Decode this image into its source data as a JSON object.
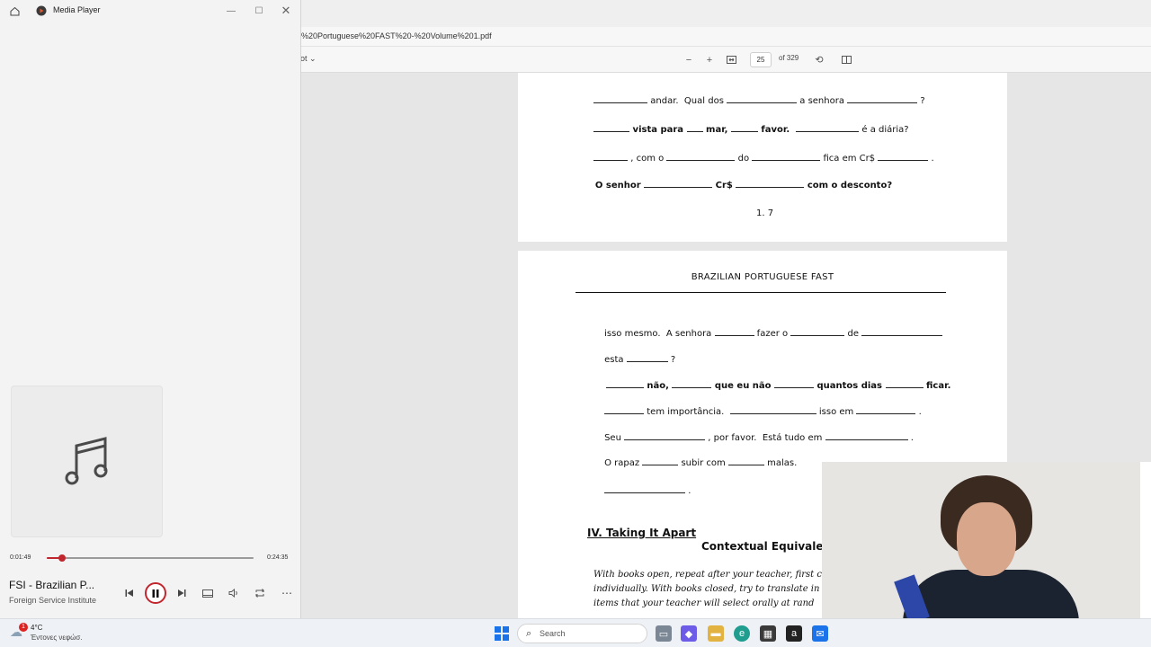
{
  "pdf_viewer": {
    "url_fragment": "%20Portuguese%20FAST%20-%20Volume%201.pdf",
    "draw_label": "ot",
    "page_current": "25",
    "page_of": "of 329",
    "page1": {
      "lines": [
        [
          "",
          " andar.  Qual dos ",
          " a senhora ",
          " ?"
        ],
        [
          "",
          " vista para ",
          " mar, ",
          " favor.  ",
          " é a diária?"
        ],
        [
          "",
          " , com o ",
          " do ",
          " fica em Cr$ ",
          " ."
        ],
        [
          "O senhor ",
          " Cr$ ",
          " com o desconto?"
        ]
      ],
      "footer": "1. 7"
    },
    "page2": {
      "header": "BRAZILIAN PORTUGUESE FAST",
      "lines": [
        [
          "isso mesmo.  A senhora ",
          " fazer o ",
          " de ",
          ""
        ],
        [
          "esta ",
          " ?"
        ],
        [
          "",
          " não, ",
          " que eu não ",
          " quantos dias ",
          " ficar."
        ],
        [
          "",
          " tem importância.  ",
          " isso em ",
          " ."
        ],
        [
          "Seu ",
          " , por favor.  Está tudo em ",
          " ."
        ],
        [
          "O rapaz ",
          " subir com ",
          " malas."
        ],
        [
          "",
          " ."
        ]
      ],
      "section_heading": "IV.  Taking It Apart",
      "subheading": "Contextual Equivalents",
      "instructions": [
        "With books open, repeat after your teacher, first c",
        "individually.  With books closed, try to translate in",
        "items that your teacher will select orally at rand"
      ]
    }
  },
  "media_player": {
    "app_title": "Media Player",
    "time_current": "0:01:49",
    "time_total": "0:24:35",
    "progress_fraction": 0.0739,
    "track_title": "FSI - Brazilian P...",
    "track_artist": "Foreign Service Institute",
    "accent_color": "#c0262d",
    "icons": {
      "album_placeholder": "music-note-icon",
      "previous": "previous-icon",
      "play_pause": "pause-icon",
      "next": "next-icon",
      "miniplayer": "miniplayer-icon",
      "volume": "volume-icon",
      "repeat": "repeat-icon",
      "more": "more-icon"
    }
  },
  "taskbar": {
    "weather_temp": "4°C",
    "weather_desc": "Έντονες νεφώσ.",
    "weather_badge": "1",
    "search_placeholder": "Search"
  }
}
